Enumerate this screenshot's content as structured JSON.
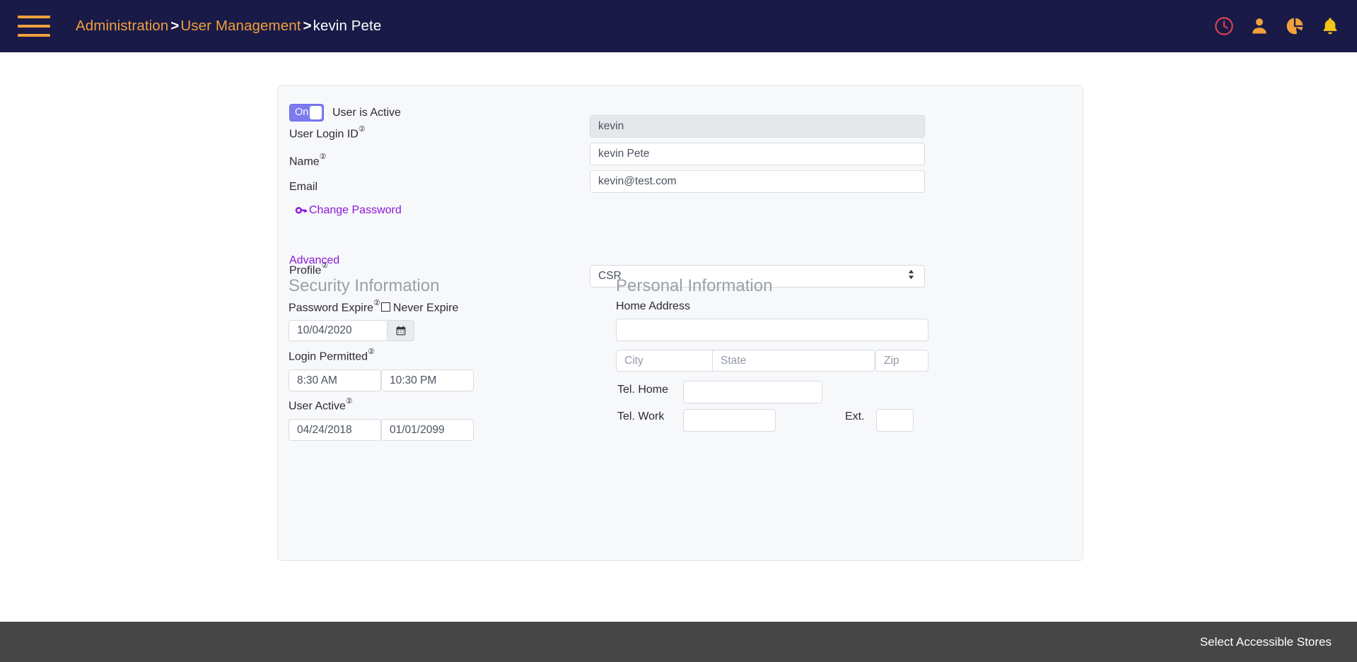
{
  "header": {
    "menu_icon": "hamburger-menu-icon",
    "breadcrumb": {
      "item1": "Administration",
      "sep1": ">",
      "item2": "User Management",
      "sep2": ">",
      "current": "kevin Pete"
    },
    "icons": [
      {
        "name": "clock-icon",
        "color": "#d9404e"
      },
      {
        "name": "user-icon",
        "color": "#f0a03c"
      },
      {
        "name": "pie-chart-icon",
        "color": "#f0a03c"
      },
      {
        "name": "bell-icon",
        "color": "#f5c518"
      }
    ],
    "background": "#191a47",
    "link_color": "#f0a03c"
  },
  "form": {
    "active_toggle": {
      "state": "On",
      "label": "User is Active",
      "on_color": "#7b7bf0"
    },
    "login_id": {
      "label": "User Login ID",
      "help": "?",
      "value": "kevin",
      "disabled": true
    },
    "name": {
      "label": "Name",
      "help": "?",
      "value": "kevin Pete"
    },
    "email": {
      "label": "Email",
      "value": "kevin@test.com"
    },
    "change_password": {
      "label": "Change Password",
      "icon": "key-icon",
      "color": "#8b17d8"
    },
    "profile": {
      "label": "Profile",
      "help": "?",
      "value": "CSR",
      "options": [
        "CSR"
      ]
    },
    "advanced": {
      "label": "Advanced",
      "color": "#8b17d8"
    }
  },
  "security": {
    "title": "Security Information",
    "password_expire": {
      "label": "Password Expire",
      "help": "?",
      "never_expire_label": "Never Expire",
      "never_expire_checked": false,
      "date": "10/04/2020",
      "calendar_icon": "calendar-icon"
    },
    "login_permitted": {
      "label": "Login Permitted",
      "help": "?",
      "from": "8:30 AM",
      "to": "10:30 PM"
    },
    "user_active": {
      "label": "User Active",
      "help": "?",
      "from": "04/24/2018",
      "to": "01/01/2099"
    }
  },
  "personal": {
    "title": "Personal Information",
    "home_address": {
      "label": "Home Address",
      "value": ""
    },
    "city": {
      "placeholder": "City",
      "value": ""
    },
    "state": {
      "placeholder": "State",
      "value": ""
    },
    "zip": {
      "placeholder": "Zip",
      "value": ""
    },
    "tel_home": {
      "label": "Tel. Home",
      "value": ""
    },
    "tel_work": {
      "label": "Tel. Work",
      "value": ""
    },
    "ext": {
      "label": "Ext.",
      "value": ""
    }
  },
  "footer": {
    "accessible_stores": "Select Accessible Stores",
    "background": "#464646"
  }
}
